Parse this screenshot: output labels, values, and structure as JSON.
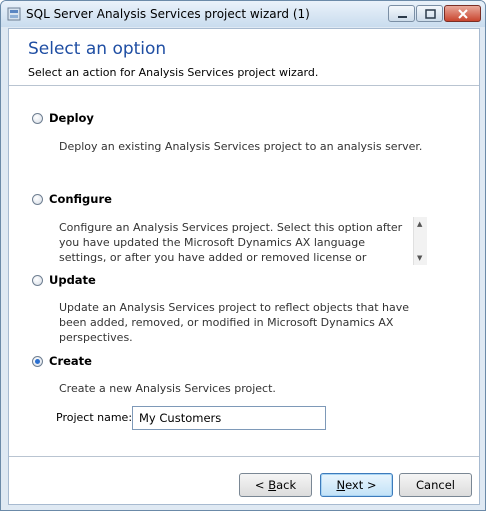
{
  "window": {
    "title": "SQL Server Analysis Services project wizard (1)"
  },
  "header": {
    "title": "Select an option",
    "subtitle": "Select an action for Analysis Services project wizard."
  },
  "options": [
    {
      "label": "Deploy",
      "description": "Deploy an existing Analysis Services project to an analysis server.",
      "checked": false
    },
    {
      "label": "Configure",
      "description": "Configure an Analysis Services project. Select this option after you have updated the Microsoft Dynamics AX language settings, or after you have added or removed license or configuration keys.",
      "checked": false
    },
    {
      "label": "Update",
      "description": "Update an Analysis Services project to reflect objects that have been added, removed, or modified in Microsoft Dynamics AX perspectives.",
      "checked": false
    },
    {
      "label": "Create",
      "description": "Create a new Analysis Services project.",
      "checked": true
    }
  ],
  "project_name": {
    "label": "Project name:",
    "value": "My Customers"
  },
  "buttons": {
    "back_prefix": "< ",
    "back_mnemonic": "B",
    "back_rest": "ack",
    "next_mnemonic": "N",
    "next_rest": "ext >",
    "cancel": "Cancel"
  },
  "colors": {
    "title_blue": "#1f4ea3",
    "selected_radio": "#2a6fd0"
  }
}
